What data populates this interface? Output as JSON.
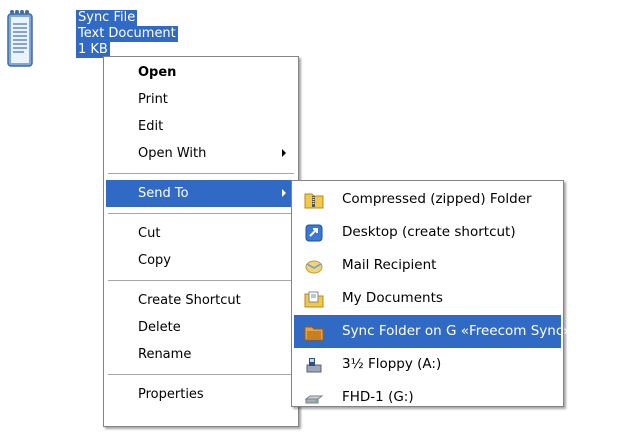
{
  "file": {
    "icon": "text-document-icon",
    "name": "Sync File",
    "type": "Text Document",
    "size": "1 KB"
  },
  "context_menu": {
    "items": [
      {
        "label": "Open",
        "bold": true
      },
      {
        "label": "Print"
      },
      {
        "label": "Edit"
      },
      {
        "label": "Open With",
        "submenu": true
      },
      {
        "label": "Send To",
        "submenu": true,
        "highlighted": true
      },
      {
        "label": "Cut"
      },
      {
        "label": "Copy"
      },
      {
        "label": "Create Shortcut"
      },
      {
        "label": "Delete"
      },
      {
        "label": "Rename"
      },
      {
        "label": "Properties"
      }
    ]
  },
  "send_to_menu": {
    "items": [
      {
        "label": "Compressed (zipped) Folder",
        "icon": "zip-folder-icon"
      },
      {
        "label": "Desktop (create shortcut)",
        "icon": "desktop-shortcut-icon"
      },
      {
        "label": "Mail Recipient",
        "icon": "mail-icon"
      },
      {
        "label": "My Documents",
        "icon": "my-documents-icon"
      },
      {
        "label": "Sync Folder on G «Freecom Sync»",
        "icon": "sync-folder-icon",
        "highlighted": true
      },
      {
        "label": "3½ Floppy (A:)",
        "icon": "floppy-icon"
      },
      {
        "label": "FHD-1 (G:)",
        "icon": "drive-icon"
      }
    ]
  },
  "colors": {
    "highlight": "#316ac5",
    "menu_border": "#848484"
  }
}
